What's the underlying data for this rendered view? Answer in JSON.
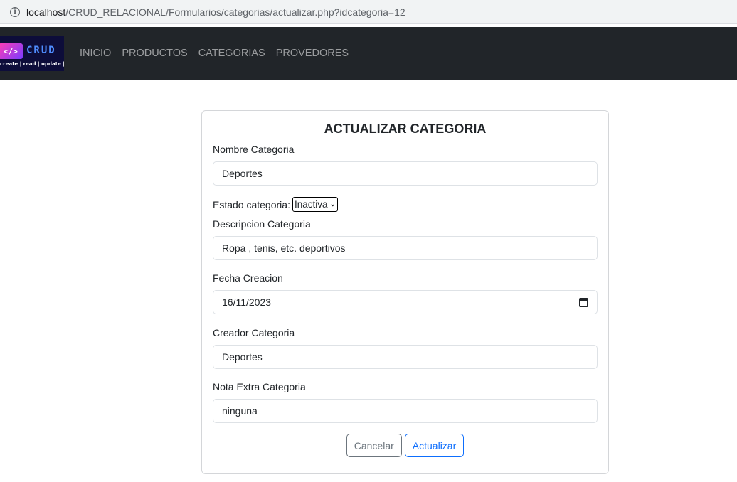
{
  "browser": {
    "url_host": "localhost",
    "url_path": "/CRUD_RELACIONAL/Formularios/categorias/actualizar.php?idcategoria=12"
  },
  "navbar": {
    "logo": {
      "symbol": "</>",
      "text": "CRUD",
      "tagline": "create | read | update | delete"
    },
    "links": [
      "INICIO",
      "PRODUCTOS",
      "CATEGORIAS",
      "PROVEDORES"
    ]
  },
  "form": {
    "title": "ACTUALIZAR CATEGORIA",
    "nombre_label": "Nombre Categoria",
    "nombre_value": "Deportes",
    "estado_label": "Estado categoria:",
    "estado_value": "Inactiva",
    "descripcion_label": "Descripcion Categoria",
    "descripcion_value": "Ropa , tenis, etc. deportivos",
    "fecha_label": "Fecha Creacion",
    "fecha_value": "16/11/2023",
    "creador_label": "Creador Categoria",
    "creador_value": "Deportes",
    "nota_label": "Nota Extra Categoria",
    "nota_value": "ninguna",
    "cancel_label": "Cancelar",
    "update_label": "Actualizar"
  },
  "colors": {
    "navbar_bg": "#212529",
    "primary": "#0d6efd",
    "secondary": "#6c757d"
  }
}
